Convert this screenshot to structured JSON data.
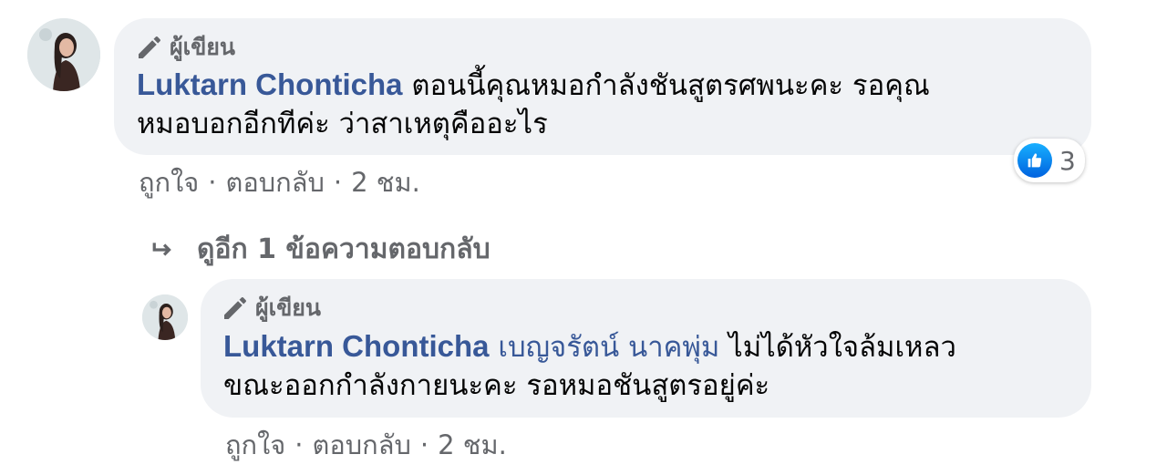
{
  "comment": {
    "badge_label": "ผู้เขียน",
    "author": "Luktarn Chonticha",
    "text_line1": "ตอนนี้คุณหมอกำลังชันสูตรศพนะคะ รอคุณ",
    "text_line2": "หมอบอกอีกทีค่ะ ว่าสาเหตุคืออะไร",
    "actions": {
      "like": "ถูกใจ",
      "reply": "ตอบกลับ",
      "time": "2 ชม.",
      "sep": "·"
    },
    "reaction_count": "3"
  },
  "view_more_replies": "ดูอีก 1 ข้อความตอบกลับ",
  "reply": {
    "badge_label": "ผู้เขียน",
    "author": "Luktarn Chonticha",
    "mention": "เบญจรัตน์ นาคพุ่ม",
    "text_line1_rest": "ไม่ได้หัวใจล้มเหลว",
    "text_line2": "ขณะออกกำลังกายนะคะ รอหมอชันสูตรอยู่ค่ะ",
    "actions": {
      "like": "ถูกใจ",
      "reply": "ตอบกลับ",
      "time": "2 ชม.",
      "sep": "·"
    }
  },
  "colors": {
    "author": "#385898",
    "meta": "#65676b",
    "bubble": "#f0f2f5",
    "like": "#1877f2"
  }
}
